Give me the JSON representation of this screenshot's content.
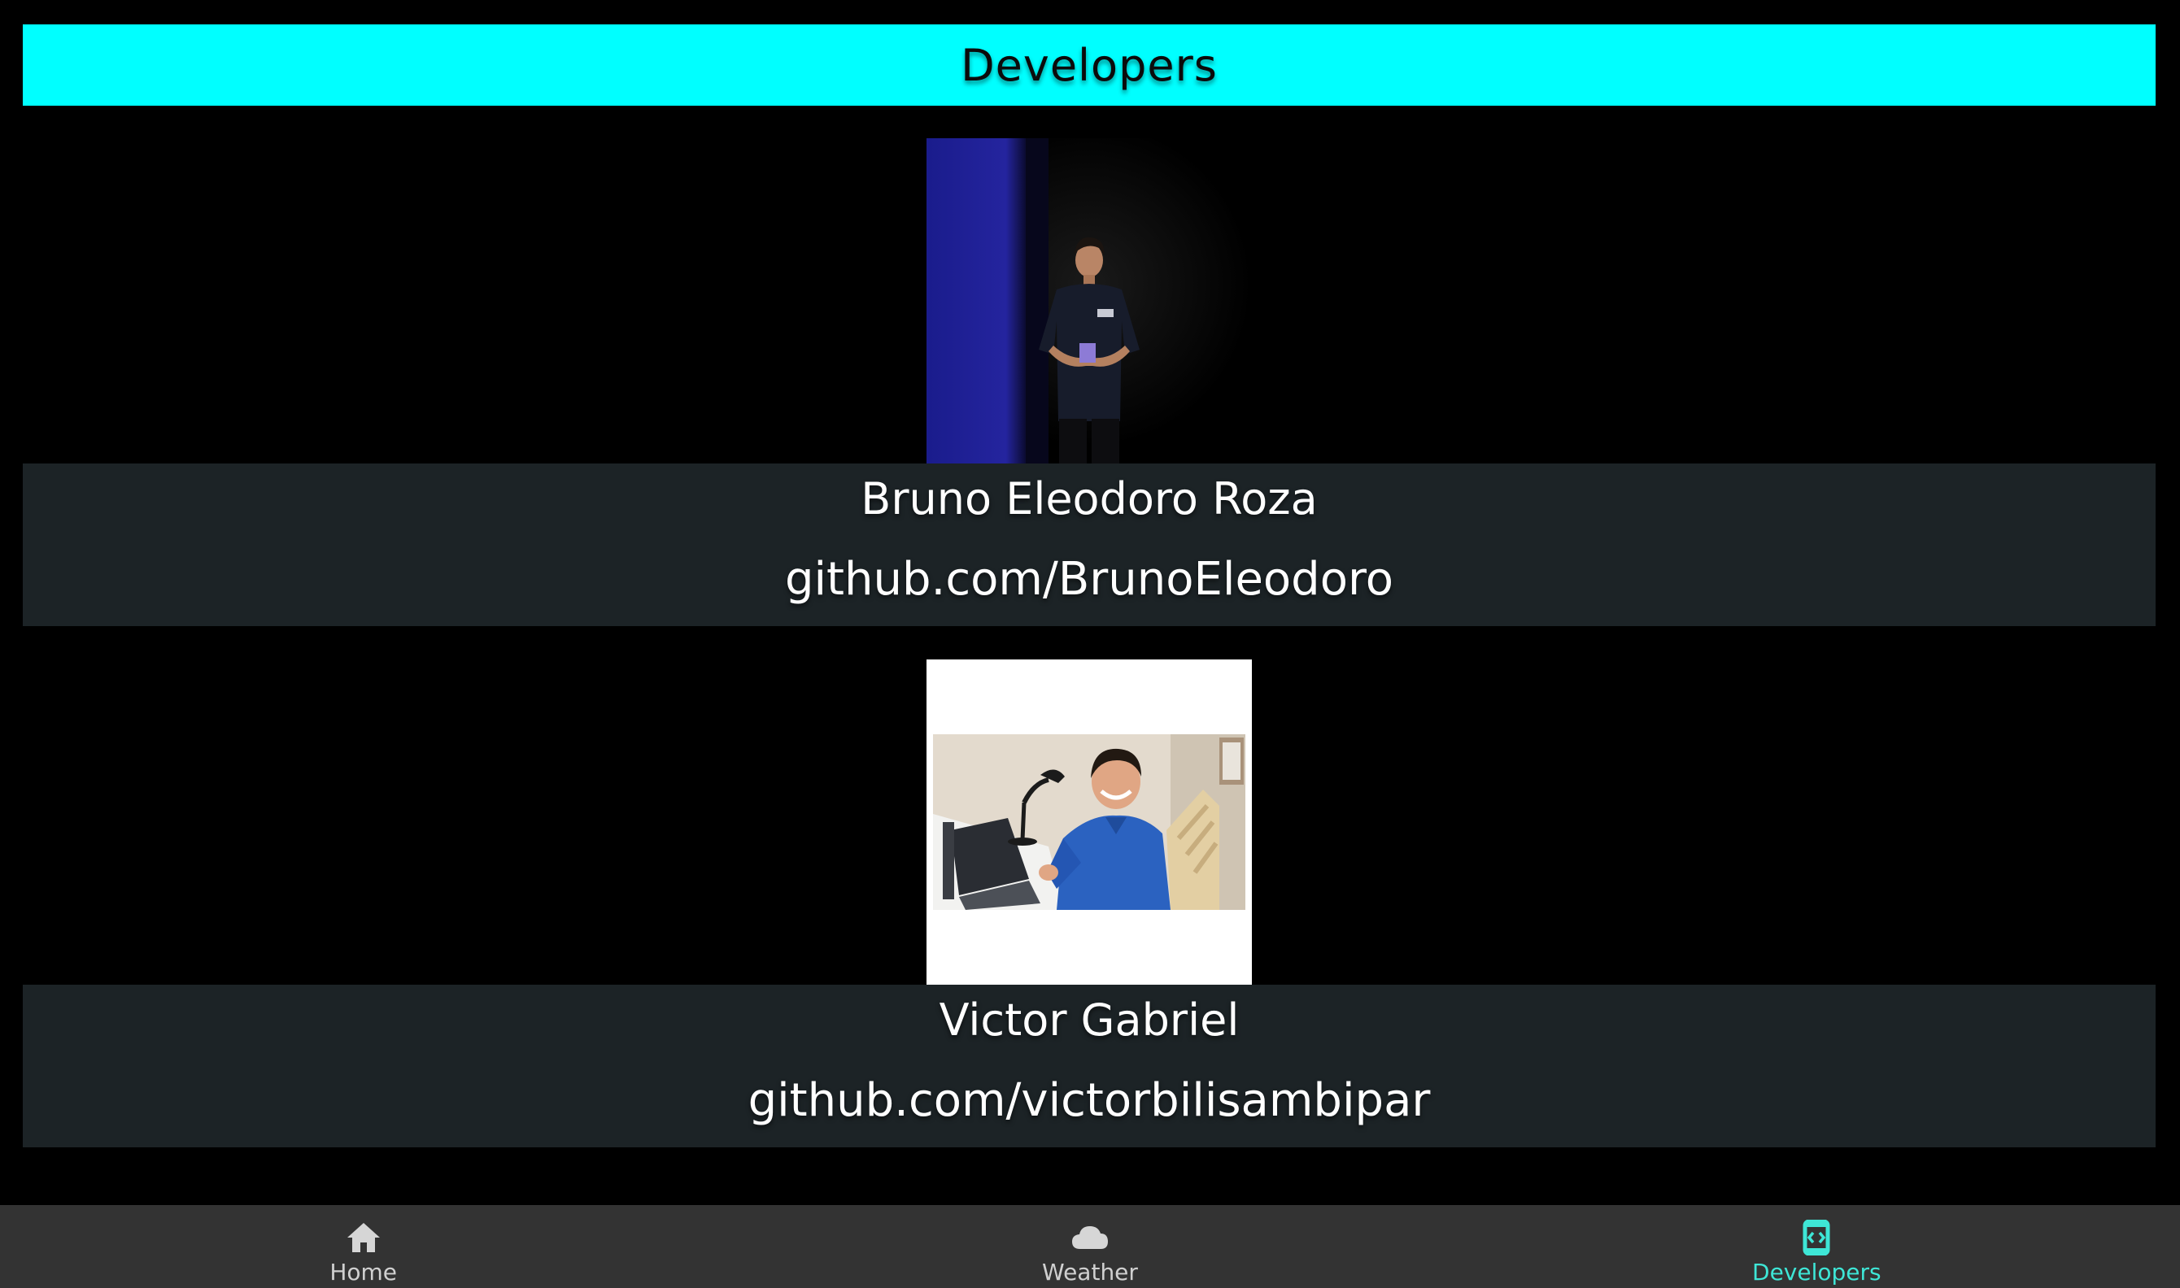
{
  "header": {
    "title": "Developers"
  },
  "developers": [
    {
      "name": "Bruno Eleodoro Roza",
      "link": "github.com/BrunoEleodoro"
    },
    {
      "name": "Victor Gabriel",
      "link": "github.com/victorbilisambipar"
    }
  ],
  "nav": {
    "tabs": [
      {
        "label": "Home",
        "icon": "home-icon",
        "active": false
      },
      {
        "label": "Weather",
        "icon": "cloud-icon",
        "active": false
      },
      {
        "label": "Developers",
        "icon": "code-icon",
        "active": true
      }
    ]
  },
  "colors": {
    "accent": "#00FFFF",
    "active_tab": "#3EE6D6",
    "card_background": "#1C2326",
    "nav_background": "#333333"
  }
}
